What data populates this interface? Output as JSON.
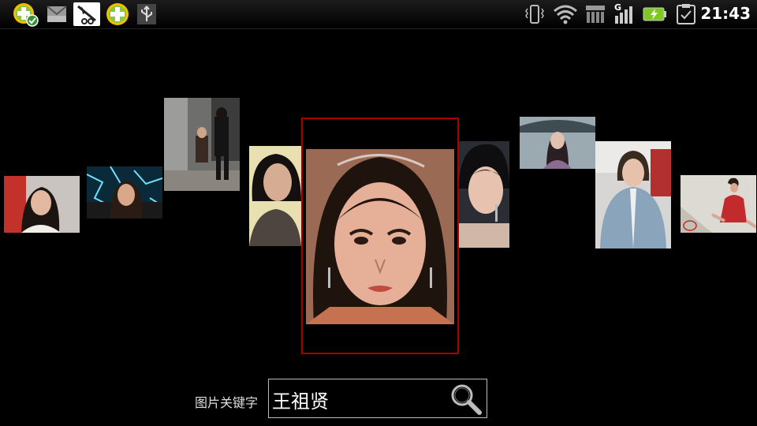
{
  "status_bar": {
    "time": "21:43",
    "network_type": "G",
    "notification_icons": [
      "app-360-security-icon",
      "email-icon",
      "feather-app-icon",
      "app-360-plus-icon",
      "usb-icon"
    ],
    "system_icons": [
      "vibrate-icon",
      "wifi-icon",
      "signal-3g-icon",
      "signal-bars-icon",
      "battery-charging-icon",
      "clipboard-icon"
    ],
    "colors": {
      "battery": "#7ec820",
      "app_green": "#8cc63f",
      "app_yellow": "#f2c000"
    }
  },
  "gallery": {
    "selected_index": 4,
    "selected_border_color": "#aa0000",
    "thumbnails": [
      {
        "name": "photo-1"
      },
      {
        "name": "photo-2"
      },
      {
        "name": "photo-3"
      },
      {
        "name": "photo-4"
      },
      {
        "name": "photo-5-selected"
      },
      {
        "name": "photo-6"
      },
      {
        "name": "photo-7"
      },
      {
        "name": "photo-8"
      },
      {
        "name": "photo-9"
      }
    ]
  },
  "search": {
    "label": "图片关键字",
    "value": "王祖贤",
    "button_icon": "search-icon"
  }
}
